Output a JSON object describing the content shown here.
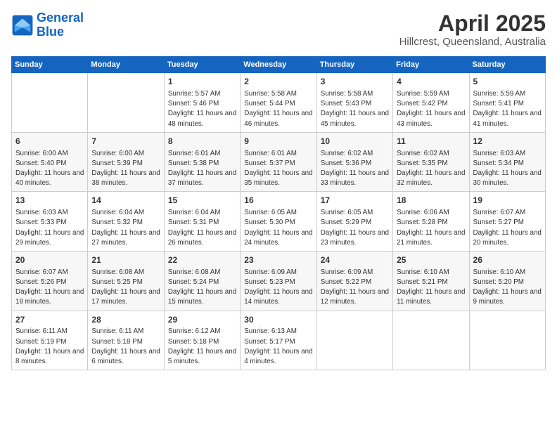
{
  "header": {
    "logo_line1": "General",
    "logo_line2": "Blue",
    "title": "April 2025",
    "subtitle": "Hillcrest, Queensland, Australia"
  },
  "weekdays": [
    "Sunday",
    "Monday",
    "Tuesday",
    "Wednesday",
    "Thursday",
    "Friday",
    "Saturday"
  ],
  "weeks": [
    [
      {
        "day": "",
        "info": ""
      },
      {
        "day": "",
        "info": ""
      },
      {
        "day": "1",
        "info": "Sunrise: 5:57 AM\nSunset: 5:46 PM\nDaylight: 11 hours and 48 minutes."
      },
      {
        "day": "2",
        "info": "Sunrise: 5:58 AM\nSunset: 5:44 PM\nDaylight: 11 hours and 46 minutes."
      },
      {
        "day": "3",
        "info": "Sunrise: 5:58 AM\nSunset: 5:43 PM\nDaylight: 11 hours and 45 minutes."
      },
      {
        "day": "4",
        "info": "Sunrise: 5:59 AM\nSunset: 5:42 PM\nDaylight: 11 hours and 43 minutes."
      },
      {
        "day": "5",
        "info": "Sunrise: 5:59 AM\nSunset: 5:41 PM\nDaylight: 11 hours and 41 minutes."
      }
    ],
    [
      {
        "day": "6",
        "info": "Sunrise: 6:00 AM\nSunset: 5:40 PM\nDaylight: 11 hours and 40 minutes."
      },
      {
        "day": "7",
        "info": "Sunrise: 6:00 AM\nSunset: 5:39 PM\nDaylight: 11 hours and 38 minutes."
      },
      {
        "day": "8",
        "info": "Sunrise: 6:01 AM\nSunset: 5:38 PM\nDaylight: 11 hours and 37 minutes."
      },
      {
        "day": "9",
        "info": "Sunrise: 6:01 AM\nSunset: 5:37 PM\nDaylight: 11 hours and 35 minutes."
      },
      {
        "day": "10",
        "info": "Sunrise: 6:02 AM\nSunset: 5:36 PM\nDaylight: 11 hours and 33 minutes."
      },
      {
        "day": "11",
        "info": "Sunrise: 6:02 AM\nSunset: 5:35 PM\nDaylight: 11 hours and 32 minutes."
      },
      {
        "day": "12",
        "info": "Sunrise: 6:03 AM\nSunset: 5:34 PM\nDaylight: 11 hours and 30 minutes."
      }
    ],
    [
      {
        "day": "13",
        "info": "Sunrise: 6:03 AM\nSunset: 5:33 PM\nDaylight: 11 hours and 29 minutes."
      },
      {
        "day": "14",
        "info": "Sunrise: 6:04 AM\nSunset: 5:32 PM\nDaylight: 11 hours and 27 minutes."
      },
      {
        "day": "15",
        "info": "Sunrise: 6:04 AM\nSunset: 5:31 PM\nDaylight: 11 hours and 26 minutes."
      },
      {
        "day": "16",
        "info": "Sunrise: 6:05 AM\nSunset: 5:30 PM\nDaylight: 11 hours and 24 minutes."
      },
      {
        "day": "17",
        "info": "Sunrise: 6:05 AM\nSunset: 5:29 PM\nDaylight: 11 hours and 23 minutes."
      },
      {
        "day": "18",
        "info": "Sunrise: 6:06 AM\nSunset: 5:28 PM\nDaylight: 11 hours and 21 minutes."
      },
      {
        "day": "19",
        "info": "Sunrise: 6:07 AM\nSunset: 5:27 PM\nDaylight: 11 hours and 20 minutes."
      }
    ],
    [
      {
        "day": "20",
        "info": "Sunrise: 6:07 AM\nSunset: 5:26 PM\nDaylight: 11 hours and 18 minutes."
      },
      {
        "day": "21",
        "info": "Sunrise: 6:08 AM\nSunset: 5:25 PM\nDaylight: 11 hours and 17 minutes."
      },
      {
        "day": "22",
        "info": "Sunrise: 6:08 AM\nSunset: 5:24 PM\nDaylight: 11 hours and 15 minutes."
      },
      {
        "day": "23",
        "info": "Sunrise: 6:09 AM\nSunset: 5:23 PM\nDaylight: 11 hours and 14 minutes."
      },
      {
        "day": "24",
        "info": "Sunrise: 6:09 AM\nSunset: 5:22 PM\nDaylight: 11 hours and 12 minutes."
      },
      {
        "day": "25",
        "info": "Sunrise: 6:10 AM\nSunset: 5:21 PM\nDaylight: 11 hours and 11 minutes."
      },
      {
        "day": "26",
        "info": "Sunrise: 6:10 AM\nSunset: 5:20 PM\nDaylight: 11 hours and 9 minutes."
      }
    ],
    [
      {
        "day": "27",
        "info": "Sunrise: 6:11 AM\nSunset: 5:19 PM\nDaylight: 11 hours and 8 minutes."
      },
      {
        "day": "28",
        "info": "Sunrise: 6:11 AM\nSunset: 5:18 PM\nDaylight: 11 hours and 6 minutes."
      },
      {
        "day": "29",
        "info": "Sunrise: 6:12 AM\nSunset: 5:18 PM\nDaylight: 11 hours and 5 minutes."
      },
      {
        "day": "30",
        "info": "Sunrise: 6:13 AM\nSunset: 5:17 PM\nDaylight: 11 hours and 4 minutes."
      },
      {
        "day": "",
        "info": ""
      },
      {
        "day": "",
        "info": ""
      },
      {
        "day": "",
        "info": ""
      }
    ]
  ]
}
